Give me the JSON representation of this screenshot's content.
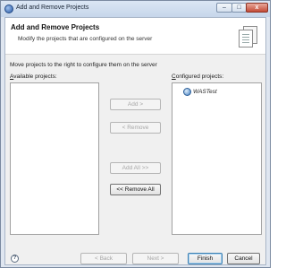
{
  "window": {
    "title": "Add and Remove Projects",
    "minimize_glyph": "–",
    "maximize_glyph": "□",
    "close_glyph": "x"
  },
  "header": {
    "title": "Add and Remove Projects",
    "subtitle": "Modify the projects that are configured on the server"
  },
  "instruction": "Move projects to the right to configure them on the server",
  "available": {
    "label_prefix": "",
    "label_mnemonic": "A",
    "label_rest": "vailable projects:",
    "items": []
  },
  "configured": {
    "label_mnemonic": "C",
    "label_rest": "onfigured projects:",
    "items": [
      {
        "label": "WASTest",
        "icon": "server-project-icon"
      }
    ]
  },
  "transfer_buttons": {
    "add": "Add >",
    "remove": "< Remove",
    "add_all": "Add All >>",
    "remove_all": "<< Remove All"
  },
  "footer": {
    "help_glyph": "?",
    "back": "< Back",
    "next": "Next >",
    "finish": "Finish",
    "cancel": "Cancel"
  },
  "colors": {
    "title_gradient_top": "#dbe6f4",
    "client_bg": "#f0f0f0",
    "default_button_border": "#3c7fb1"
  }
}
